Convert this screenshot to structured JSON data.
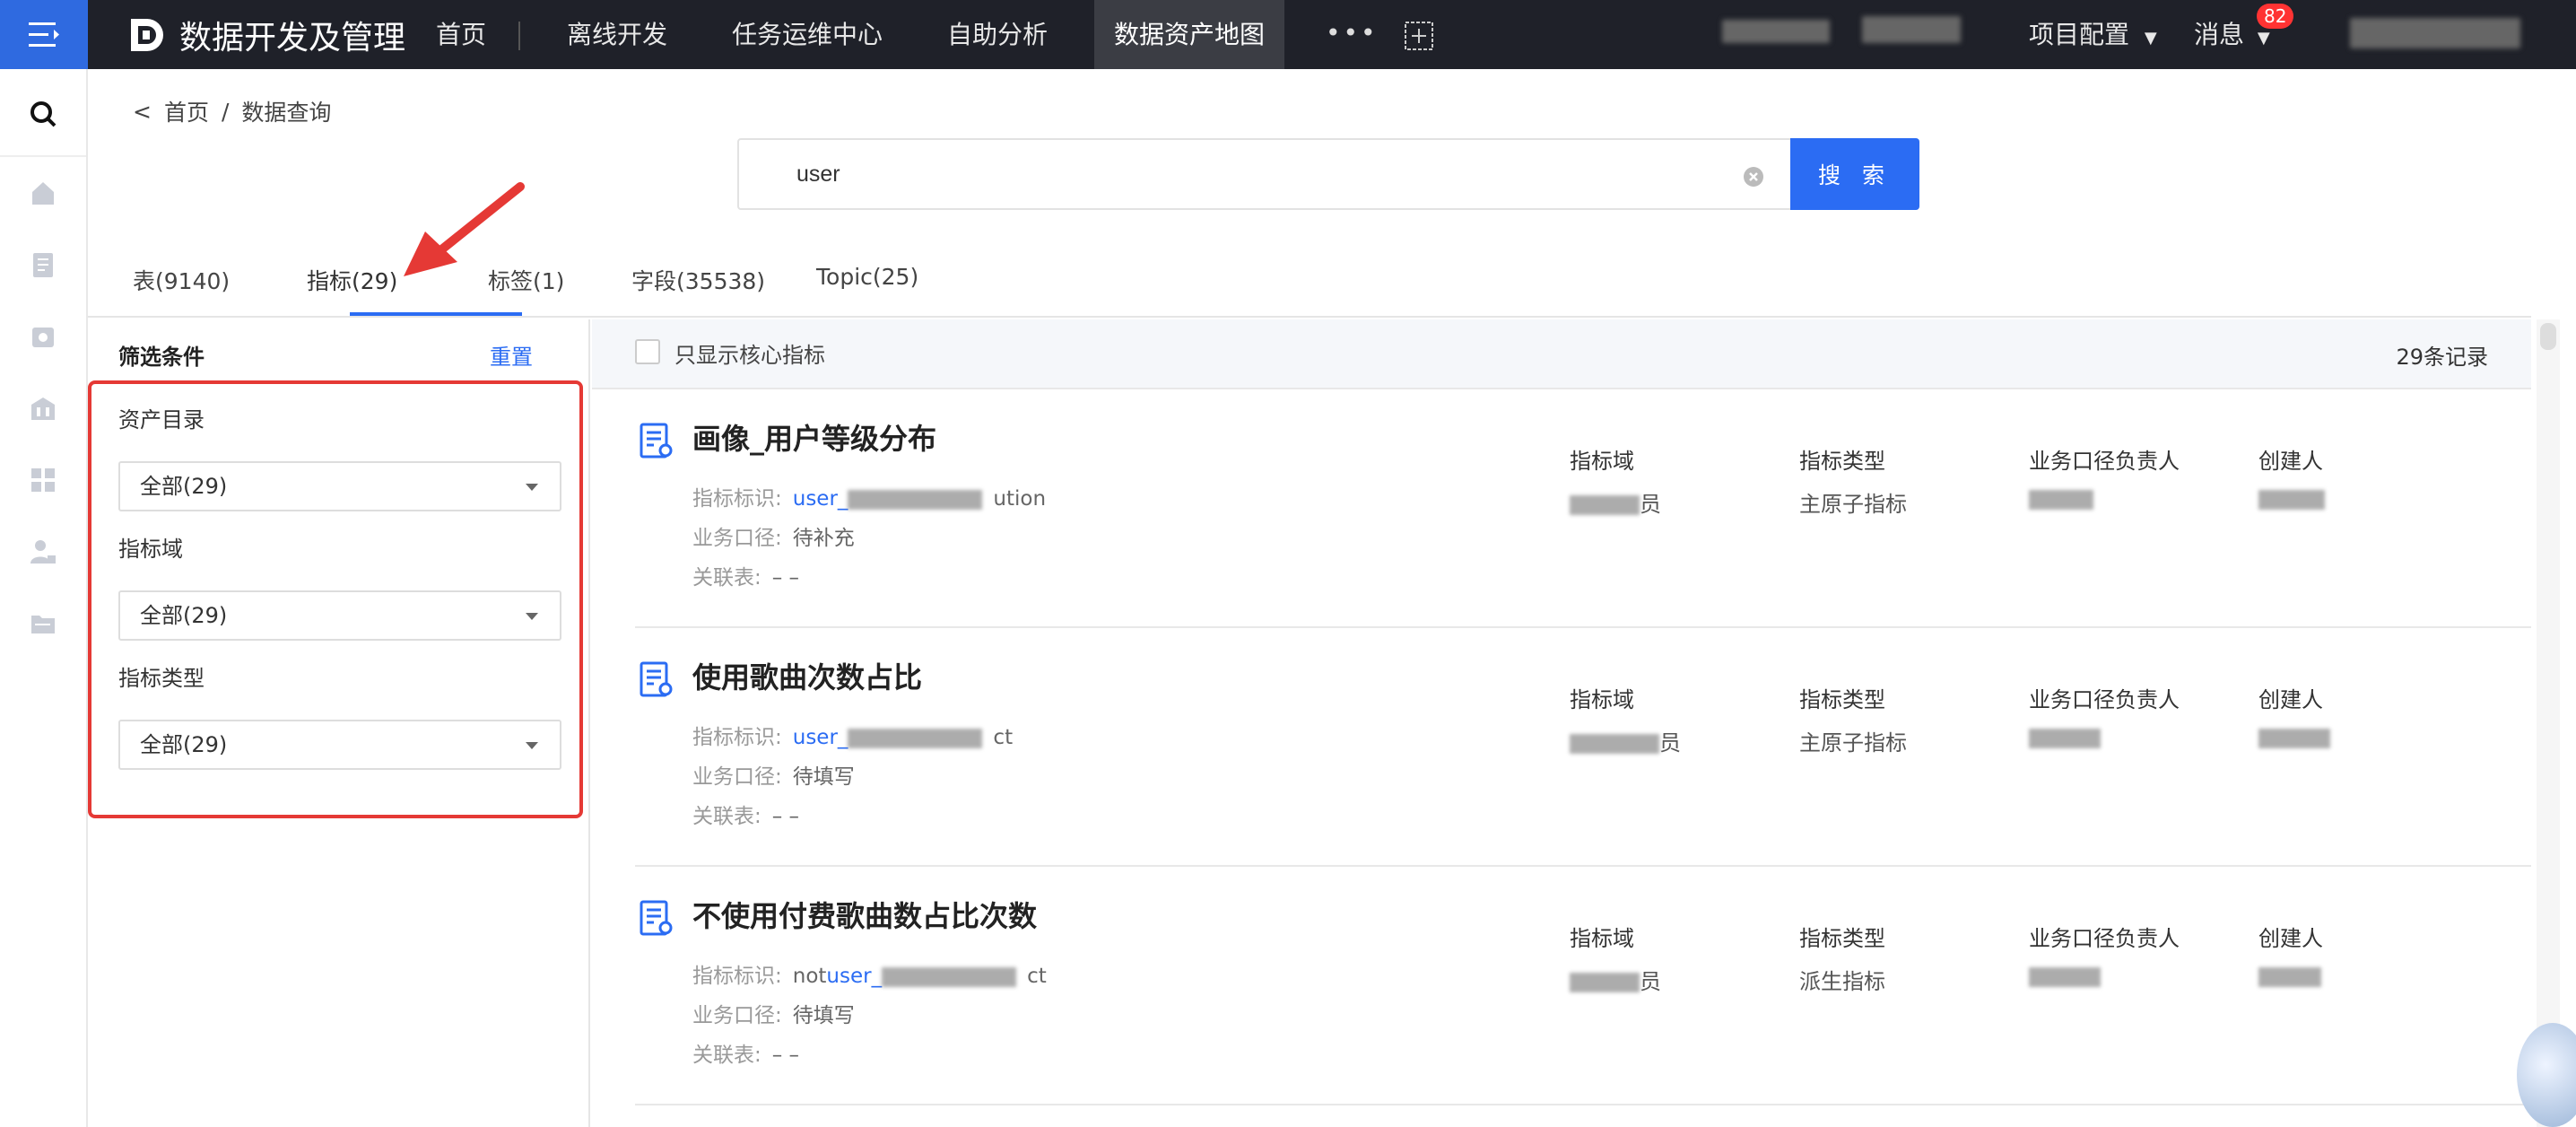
{
  "topbar": {
    "brand": "数据开发及管理",
    "nav": [
      "首页",
      "离线开发",
      "任务运维中心",
      "自助分析",
      "数据资产地图"
    ],
    "more": "•••",
    "right_items": [
      "项目配置",
      "消息"
    ],
    "badge_count": "82"
  },
  "breadcrumb": {
    "back": "<",
    "home": "首页",
    "sep": "/",
    "current": "数据查询"
  },
  "search": {
    "value": "user",
    "button": "搜 索"
  },
  "tabs": [
    "表(9140)",
    "指标(29)",
    "标签(1)",
    "字段(35538)",
    "Topic(25)"
  ],
  "active_tab": 1,
  "filter": {
    "title": "筛选条件",
    "reset": "重置",
    "groups": [
      {
        "label": "资产目录",
        "value": "全部(29)"
      },
      {
        "label": "指标域",
        "value": "全部(29)"
      },
      {
        "label": "指标类型",
        "value": "全部(29)"
      }
    ]
  },
  "results_bar": {
    "only_core": "只显示核心指标",
    "count": "29条记录"
  },
  "columns": [
    "指标域",
    "指标类型",
    "业务口径负责人",
    "创建人"
  ],
  "meta_labels": {
    "id": "指标标识:",
    "caliber": "业务口径:",
    "table": "关联表:"
  },
  "results": [
    {
      "title": "画像_用户等级分布",
      "id_prefix": "",
      "id_link": "user_",
      "id_suffix": "ution",
      "caliber": "待补充",
      "table": "– –",
      "domain_suffix": "员",
      "type": "主原子指标"
    },
    {
      "title": "使用歌曲次数占比",
      "id_prefix": "",
      "id_link": "user_",
      "id_suffix": "ct",
      "caliber": "待填写",
      "table": "– –",
      "domain_suffix": "员",
      "type": "主原子指标"
    },
    {
      "title": "不使用付费歌曲数占比次数",
      "id_prefix": "not",
      "id_link": "user_",
      "id_suffix": "ct",
      "caliber": "待填写",
      "table": "– –",
      "domain_suffix": "员",
      "type": "派生指标"
    }
  ],
  "colors": {
    "accent": "#2b6cf3",
    "topbar": "#1f2129",
    "highlight_box": "#e53935",
    "badge": "#ff3333"
  }
}
